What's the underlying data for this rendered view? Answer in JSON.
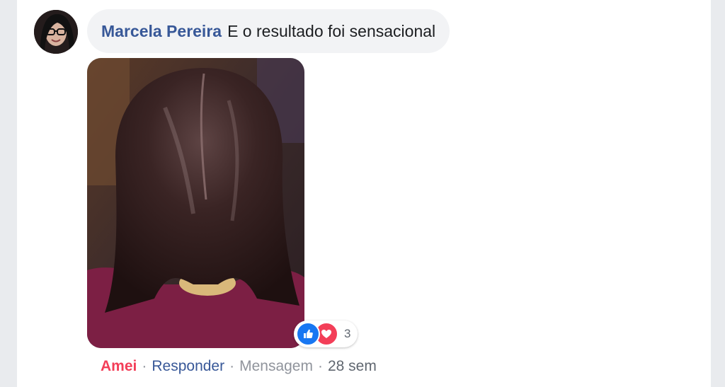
{
  "comment": {
    "author": "Marcela Pereira",
    "text": "E o resultado foi sensacional"
  },
  "reactions": {
    "icons": [
      "like-icon",
      "love-icon"
    ],
    "count": "3"
  },
  "actions": {
    "reacted": "Amei",
    "reply": "Responder",
    "message": "Mensagem",
    "separator": "·",
    "time": "28 sem"
  },
  "colors": {
    "link": "#385898",
    "love": "#f33e58",
    "like": "#1877f2",
    "bubble": "#f2f3f5"
  }
}
